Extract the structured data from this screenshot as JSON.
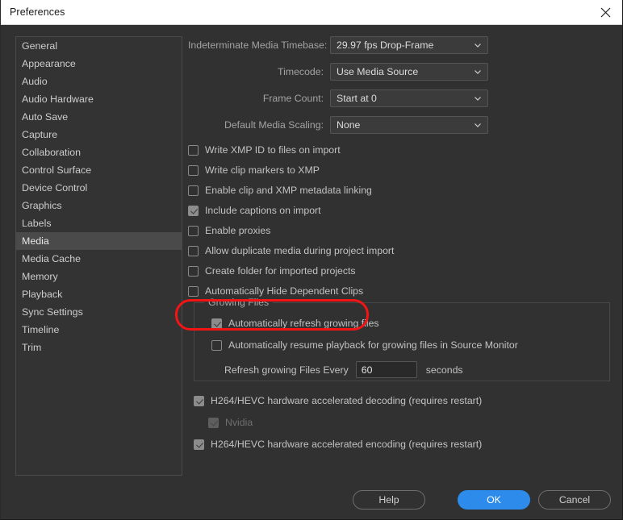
{
  "window": {
    "title": "Preferences",
    "close_icon": "close-icon"
  },
  "sidebar": {
    "items": [
      {
        "label": "General",
        "selected": false
      },
      {
        "label": "Appearance",
        "selected": false
      },
      {
        "label": "Audio",
        "selected": false
      },
      {
        "label": "Audio Hardware",
        "selected": false
      },
      {
        "label": "Auto Save",
        "selected": false
      },
      {
        "label": "Capture",
        "selected": false
      },
      {
        "label": "Collaboration",
        "selected": false
      },
      {
        "label": "Control Surface",
        "selected": false
      },
      {
        "label": "Device Control",
        "selected": false
      },
      {
        "label": "Graphics",
        "selected": false
      },
      {
        "label": "Labels",
        "selected": false
      },
      {
        "label": "Media",
        "selected": true
      },
      {
        "label": "Media Cache",
        "selected": false
      },
      {
        "label": "Memory",
        "selected": false
      },
      {
        "label": "Playback",
        "selected": false
      },
      {
        "label": "Sync Settings",
        "selected": false
      },
      {
        "label": "Timeline",
        "selected": false
      },
      {
        "label": "Trim",
        "selected": false
      }
    ]
  },
  "main": {
    "dropdowns": [
      {
        "label": "Indeterminate Media Timebase:",
        "value": "29.97 fps Drop-Frame",
        "icon": "chevron-down-icon"
      },
      {
        "label": "Timecode:",
        "value": "Use Media Source",
        "icon": "chevron-down-icon"
      },
      {
        "label": "Frame Count:",
        "value": "Start at 0",
        "icon": "chevron-down-icon"
      },
      {
        "label": "Default Media Scaling:",
        "value": "None",
        "icon": "chevron-down-icon"
      }
    ],
    "checkboxes": [
      {
        "label": "Write XMP ID to files on import",
        "checked": false
      },
      {
        "label": "Write clip markers to XMP",
        "checked": false
      },
      {
        "label": "Enable clip and XMP metadata linking",
        "checked": false
      },
      {
        "label": "Include captions on import",
        "checked": true
      },
      {
        "label": "Enable proxies",
        "checked": false
      },
      {
        "label": "Allow duplicate media during project import",
        "checked": false
      },
      {
        "label": "Create folder for imported projects",
        "checked": false
      },
      {
        "label": "Automatically Hide Dependent Clips",
        "checked": false
      }
    ],
    "growing_files": {
      "legend": "Growing Files",
      "auto_refresh": {
        "label": "Automatically refresh growing files",
        "checked": true
      },
      "auto_resume": {
        "label": "Automatically resume playback for growing files in Source Monitor",
        "checked": false
      },
      "refresh_interval": {
        "label": "Refresh growing Files Every",
        "value": "60",
        "unit": "seconds"
      }
    },
    "hardware": [
      {
        "label": "H264/HEVC hardware accelerated decoding (requires restart)",
        "checked": true,
        "disabled": false,
        "indent": false
      },
      {
        "label": "Nvidia",
        "checked": true,
        "disabled": true,
        "indent": true
      },
      {
        "label": "H264/HEVC hardware accelerated encoding (requires restart)",
        "checked": true,
        "disabled": false,
        "indent": false
      }
    ]
  },
  "footer": {
    "help_label": "Help",
    "ok_label": "OK",
    "cancel_label": "Cancel"
  },
  "annotation": {
    "color": "#f51414",
    "target": "Growing Files / Automatically refresh growing files"
  },
  "colors": {
    "accent_blue": "#2d8ceb",
    "window_bg": "#313131",
    "titlebar_bg": "#ffffff",
    "selected_item_bg": "#4a4a4a"
  }
}
